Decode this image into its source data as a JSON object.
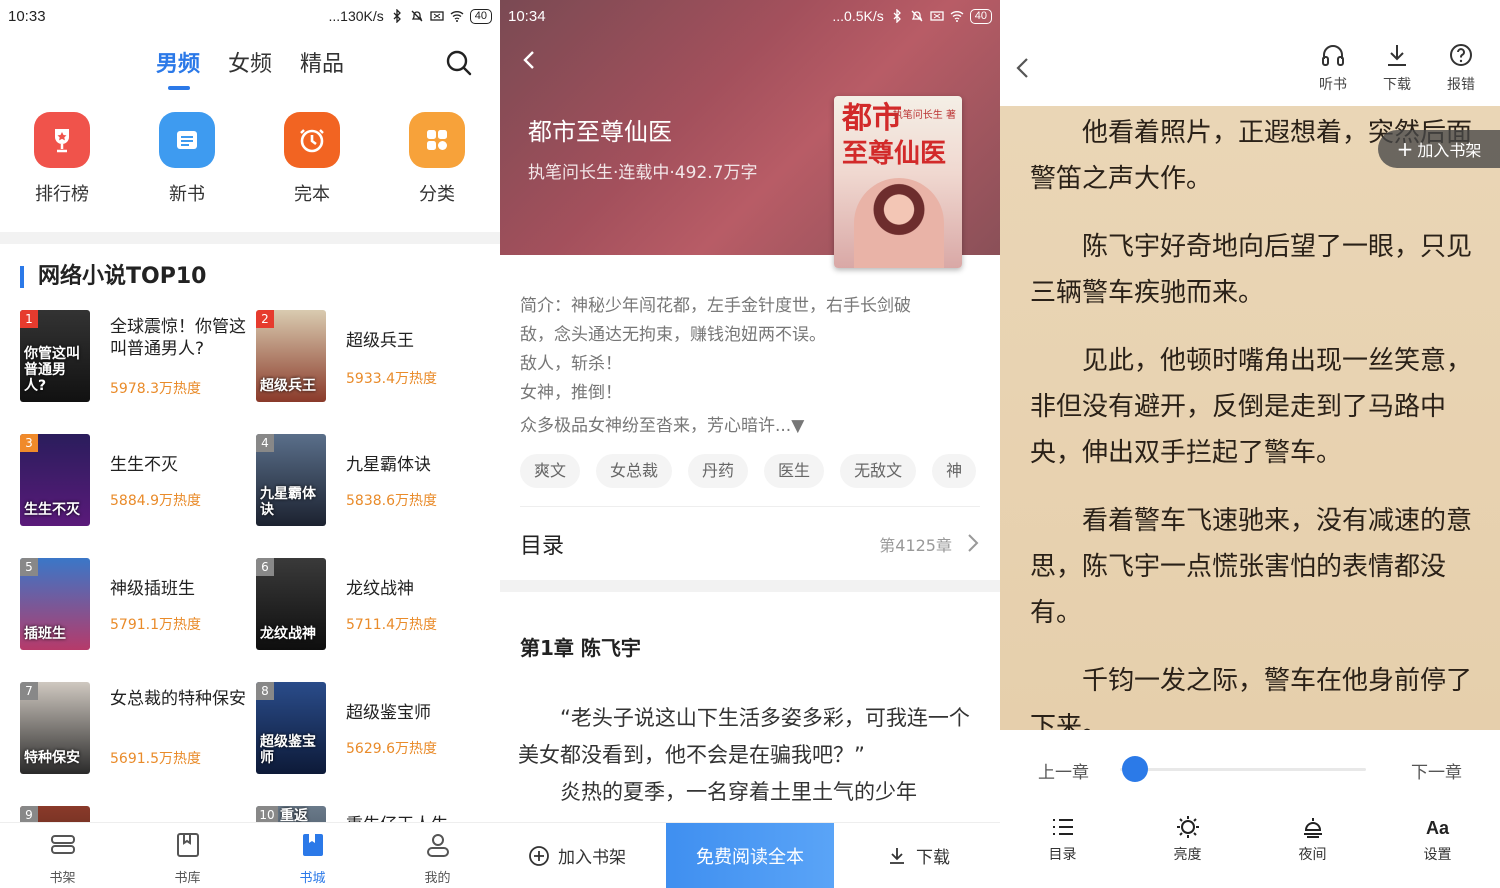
{
  "screen1": {
    "status": {
      "time": "10:33",
      "speed": "...130K/s",
      "battery": "40"
    },
    "tabs": [
      {
        "label": "男频",
        "active": true
      },
      {
        "label": "女频",
        "active": false
      },
      {
        "label": "精品",
        "active": false
      }
    ],
    "search_icon": "search-icon",
    "categories": [
      {
        "label": "排行榜",
        "icon": "trophy-icon",
        "color": "#f0534b"
      },
      {
        "label": "新书",
        "icon": "book-list-icon",
        "color": "#3e9bf0"
      },
      {
        "label": "完本",
        "icon": "clock-icon",
        "color": "#f26422"
      },
      {
        "label": "分类",
        "icon": "grid-icon",
        "color": "#f7a23a"
      }
    ],
    "section_title": "网络小说TOP10",
    "ranking": [
      {
        "rank": "1",
        "title": "全球震惊！你管这叫普通男人?",
        "heat": "5978.3万热度",
        "cover_text": "你管这叫普通男人?"
      },
      {
        "rank": "2",
        "title": "超级兵王",
        "heat": "5933.4万热度",
        "cover_text": "超级兵王"
      },
      {
        "rank": "3",
        "title": "生生不灭",
        "heat": "5884.9万热度",
        "cover_text": "生生不灭"
      },
      {
        "rank": "4",
        "title": "九星霸体诀",
        "heat": "5838.6万热度",
        "cover_text": "九星霸体诀"
      },
      {
        "rank": "5",
        "title": "神级插班生",
        "heat": "5791.1万热度",
        "cover_text": "插班生"
      },
      {
        "rank": "6",
        "title": "龙纹战神",
        "heat": "5711.4万热度",
        "cover_text": "龙纹战神"
      },
      {
        "rank": "7",
        "title": "女总裁的特种保安",
        "heat": "5691.5万热度",
        "cover_text": "特种保安"
      },
      {
        "rank": "8",
        "title": "超级鉴宝师",
        "heat": "5629.6万热度",
        "cover_text": "超级鉴宝师"
      },
      {
        "rank": "9",
        "title": "",
        "heat": "",
        "cover_text": ""
      },
      {
        "rank": "10",
        "title": "重生仔王人生",
        "heat": "",
        "cover_text": "重返"
      }
    ],
    "bottom_nav": [
      {
        "label": "书架",
        "icon": "bookshelf-icon",
        "active": false
      },
      {
        "label": "书库",
        "icon": "library-icon",
        "active": false
      },
      {
        "label": "书城",
        "icon": "bookstore-icon",
        "active": true
      },
      {
        "label": "我的",
        "icon": "profile-icon",
        "active": false
      }
    ]
  },
  "screen2": {
    "status": {
      "time": "10:34",
      "speed": "...0.5K/s",
      "battery": "40"
    },
    "book_title": "都市至尊仙医",
    "book_meta": "执笔问长生·连载中·492.7万字",
    "cover_title_line1": "都市",
    "cover_title_line2": "至尊仙医",
    "cover_author": "执笔问长生 著",
    "intro_lines": [
      "简介：神秘少年闯花都，左手金针度世，右手长剑破",
      "敌，念头通达无拘束，赚钱泡妞两不误。",
      "敌人，斩杀！",
      "女神，推倒！",
      "众多极品女神纷至沓来，芳心暗许...▼"
    ],
    "tags": [
      "爽文",
      "女总裁",
      "丹药",
      "医生",
      "无敌文",
      "神"
    ],
    "toc_label": "目录",
    "toc_count": "第4125章",
    "chapter_title": "第1章 陈飞宇",
    "chapter_paragraphs": [
      "“老头子说这山下生活多姿多彩，可我连一个美女都没看到，他不会是在骗我吧？”",
      "炎热的夏季，一名穿着土里土气的少年"
    ],
    "bottom": {
      "add_shelf": "加入书架",
      "read_free": "免费阅读全本",
      "download": "下载"
    }
  },
  "screen3": {
    "top_actions": [
      {
        "label": "听书",
        "icon": "headphones-icon"
      },
      {
        "label": "下载",
        "icon": "download-icon"
      },
      {
        "label": "报错",
        "icon": "help-circle-icon"
      }
    ],
    "add_shelf": "加入书架",
    "paragraphs": [
      "他看着照片，正遐想着，突然后面警笛之声大作。",
      "陈飞宇好奇地向后望了一眼，只见三辆警车疾驰而来。",
      "见此，他顿时嘴角出现一丝笑意，非但没有避开，反倒是走到了马路中央，伸出双手拦起了警车。",
      "看着警车飞速驰来，没有减速的意思，陈飞宇一点慌张害怕的表情都没有。",
      "千钧一发之际，警车在他身前停了下来。"
    ],
    "prev_chapter": "上一章",
    "next_chapter": "下一章",
    "progress": 0.01,
    "tools": [
      {
        "label": "目录",
        "icon": "list-icon"
      },
      {
        "label": "亮度",
        "icon": "brightness-icon"
      },
      {
        "label": "夜间",
        "icon": "night-icon"
      },
      {
        "label": "设置",
        "icon": "font-settings-icon"
      }
    ]
  }
}
